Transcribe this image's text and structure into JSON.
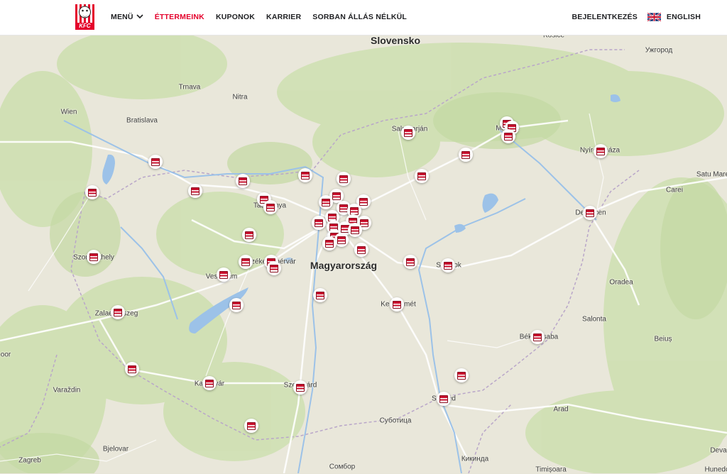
{
  "header": {
    "logo_text": "KFC",
    "nav": [
      {
        "label": "MENÜ",
        "active": false,
        "dropdown": true
      },
      {
        "label": "ÉTTERMEINK",
        "active": true,
        "dropdown": false
      },
      {
        "label": "KUPONOK",
        "active": false,
        "dropdown": false
      },
      {
        "label": "KARRIER",
        "active": false,
        "dropdown": false
      },
      {
        "label": "SORBAN ÁLLÁS NÉLKÜL",
        "active": false,
        "dropdown": false
      }
    ],
    "login_label": "BEJELENTKEZÉS",
    "language_label": "ENGLISH",
    "language_flag_icon": "uk-flag-icon"
  },
  "colors": {
    "brand_red": "#e4002b",
    "map_land": "#e8e6d9",
    "water": "#9cc2e8"
  },
  "map": {
    "place_labels": {
      "slovensko": "Slovensko",
      "magyarorszag": "Magyarország",
      "kosice": "Košice",
      "uzhgorod": "Ужгород",
      "trnava": "Trnava",
      "nitra": "Nitra",
      "wien": "Wien",
      "bratislava": "Bratislava",
      "salgotarjan": "Salgótarján",
      "miskolc": "Miskolc",
      "nyiregyhaza": "Nyíregyháza",
      "satu_mare": "Satu Mare",
      "carei": "Carei",
      "tatabanya": "Tatabánya",
      "debrecen": "Debrecen",
      "szombathely": "Szombathely",
      "szekesfehervar": "Székesfehérvár",
      "veszprem": "Veszprém",
      "szolnok": "Szolnok",
      "oradea": "Oradea",
      "zalaegerszeg": "Zalaegerszeg",
      "kecskemet": "Kecskemét",
      "salonta": "Salonta",
      "bekescsaba": "Békéscsaba",
      "beius": "Beiuș",
      "oor": "oor",
      "kaposvar": "Kaposvár",
      "szekszard": "Szekszárd",
      "varazdin": "Varaždin",
      "szeged": "Szeged",
      "arad": "Arad",
      "subotica": "Суботица",
      "zagreb": "Zagreb",
      "bjelovar": "Bjelovar",
      "sombor": "Сомбор",
      "kikinda": "Кикинда",
      "timisoara": "Timișoara",
      "hunedoara": "Hunedo",
      "deva": "Deva"
    }
  }
}
